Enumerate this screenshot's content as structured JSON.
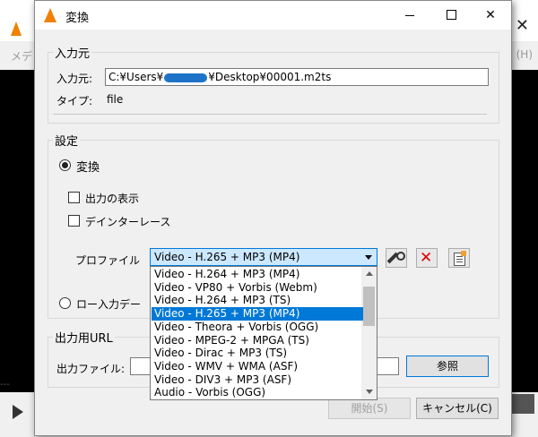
{
  "background_app": {
    "menu_left": "メデ",
    "menu_right": "(H)",
    "slider_text": "---"
  },
  "dialog": {
    "title": "変換",
    "source_group": {
      "label": "入力元",
      "source_label": "入力元:",
      "path_before": "C:¥Users¥",
      "path_after": "¥Desktop¥00001.m2ts",
      "type_label": "タイプ:",
      "type_value": "file"
    },
    "settings_group": {
      "label": "設定",
      "convert_label": "変換",
      "show_output_label": "出力の表示",
      "deinterlace_label": "デインターレース",
      "profile_label": "プロファイル",
      "profile_selected": "Video - H.265 + MP3 (MP4)",
      "raw_dump_label": "ロー入力デー"
    },
    "profile_options": [
      "Video - H.264 + MP3 (MP4)",
      "Video - VP80 + Vorbis (Webm)",
      "Video - H.264 + MP3 (TS)",
      "Video - H.265 + MP3 (MP4)",
      "Video - Theora + Vorbis (OGG)",
      "Video - MPEG-2 + MPGA (TS)",
      "Video - Dirac + MP3 (TS)",
      "Video - WMV + WMA (ASF)",
      "Video - DIV3 + MP3 (ASF)",
      "Audio - Vorbis (OGG)"
    ],
    "output_group": {
      "label": "出力用URL",
      "file_label": "出力ファイル:",
      "browse_button": "参照"
    },
    "start_button": "開始(S)",
    "cancel_button": "キャンセル(C)"
  }
}
